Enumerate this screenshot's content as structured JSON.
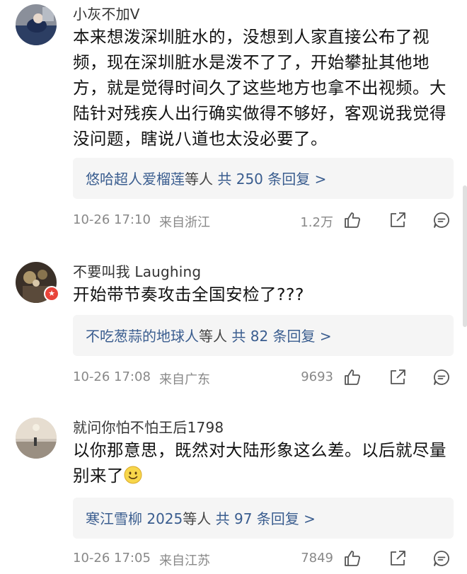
{
  "comments": [
    {
      "username": "小灰不加V",
      "lines": [
        "本来想泼深圳脏水的，没想到人家直接公布了视",
        "频，现在深圳脏水是泼不了了，开始攀扯其他地",
        "方，就是觉得时间久了这些地方也拿不出视频。大",
        "陆针对残疾人出行确实做得不够好，客观说我觉得",
        "没问题，瞎说八道也太没必要了。"
      ],
      "reply_names": "悠哈超人爱榴莲",
      "reply_mid": "等人",
      "reply_count": "共 250 条回复 >",
      "time": "10-26 17:10",
      "location": "来自浙江",
      "likes": "1.2万"
    },
    {
      "username": "不要叫我 Laughing",
      "lines": [
        "开始带节奏攻击全国安检了???"
      ],
      "reply_names": "不吃葱蒜的地球人",
      "reply_mid": "等人",
      "reply_count": "共 82 条回复 >",
      "time": "10-26 17:08",
      "location": "来自广东",
      "likes": "9693"
    },
    {
      "username": "就问你怕不怕王后1798",
      "lines": [
        "以你那意思，既然对大陆形象这么差。以后就尽量",
        "别来了"
      ],
      "reply_names": "寒江雪柳 2025",
      "reply_mid": "等人",
      "reply_count": "共 97 条回复 >",
      "time": "10-26 17:05",
      "location": "来自江苏",
      "likes": "7849"
    }
  ],
  "icons": {
    "like": "thumbs-up-icon",
    "share": "share-icon",
    "reply": "comment-icon",
    "emoji": "smile-emoji-icon",
    "badge": "star-badge-icon"
  },
  "colors": {
    "link": "#3a5d8f",
    "meta": "#888888",
    "reply_bg": "#f5f5f5",
    "badge": "#e8443a"
  }
}
